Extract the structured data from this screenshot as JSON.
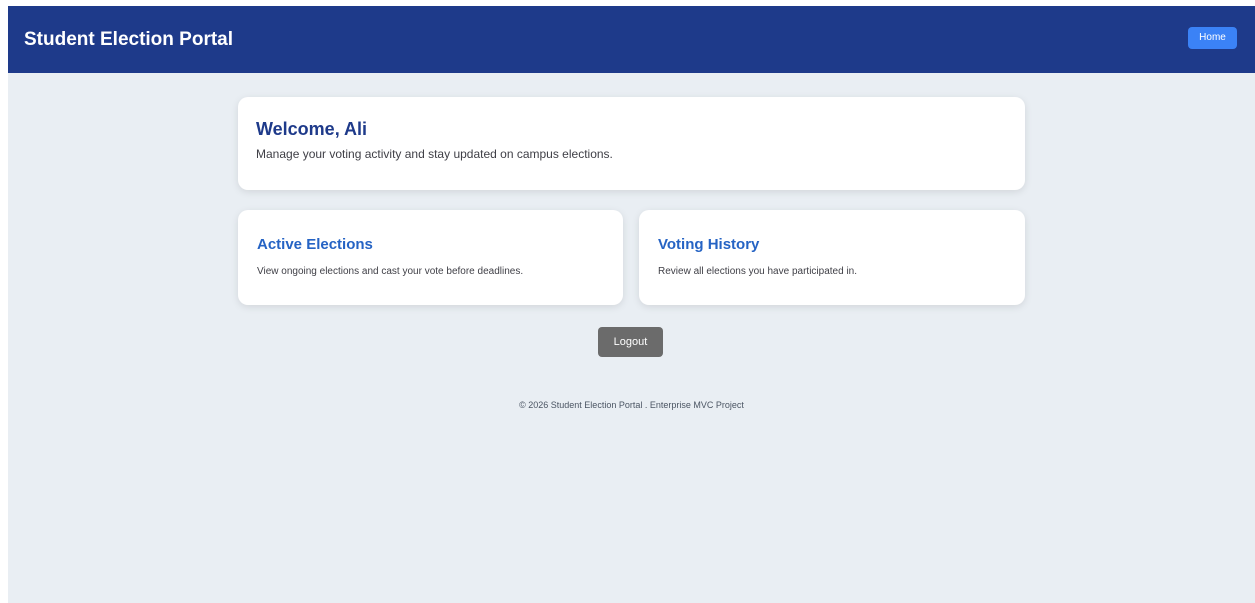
{
  "navbar": {
    "brand": "Student Election Portal",
    "home_label": "Home"
  },
  "welcome": {
    "title": "Welcome, Ali",
    "subtitle": "Manage your voting activity and stay updated on campus elections."
  },
  "cards": [
    {
      "title": "Active Elections",
      "description": "View ongoing elections and cast your vote before deadlines."
    },
    {
      "title": "Voting History",
      "description": "Review all elections you have participated in."
    }
  ],
  "logout_label": "Logout",
  "footer": "© 2026 Student Election Portal . Enterprise MVC Project",
  "colors": {
    "navbar": "#1e3a8a",
    "home_button": "#3b82f6",
    "card_title": "#2563c4",
    "logout_button": "#6b6b6b",
    "background": "#e9eef3"
  }
}
